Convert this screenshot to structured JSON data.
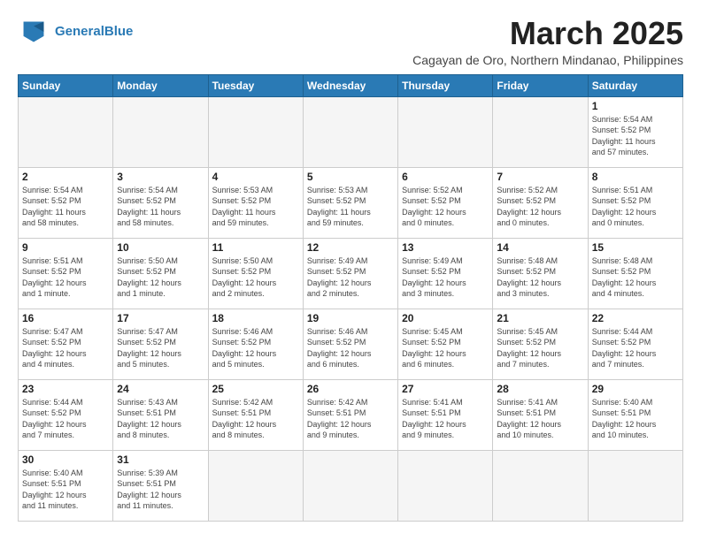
{
  "header": {
    "logo_line1": "General",
    "logo_line2": "Blue",
    "month_title": "March 2025",
    "subtitle": "Cagayan de Oro, Northern Mindanao, Philippines"
  },
  "weekdays": [
    "Sunday",
    "Monday",
    "Tuesday",
    "Wednesday",
    "Thursday",
    "Friday",
    "Saturday"
  ],
  "weeks": [
    [
      {
        "day": "",
        "info": ""
      },
      {
        "day": "",
        "info": ""
      },
      {
        "day": "",
        "info": ""
      },
      {
        "day": "",
        "info": ""
      },
      {
        "day": "",
        "info": ""
      },
      {
        "day": "",
        "info": ""
      },
      {
        "day": "1",
        "info": "Sunrise: 5:54 AM\nSunset: 5:52 PM\nDaylight: 11 hours\nand 57 minutes."
      }
    ],
    [
      {
        "day": "2",
        "info": "Sunrise: 5:54 AM\nSunset: 5:52 PM\nDaylight: 11 hours\nand 58 minutes."
      },
      {
        "day": "3",
        "info": "Sunrise: 5:54 AM\nSunset: 5:52 PM\nDaylight: 11 hours\nand 58 minutes."
      },
      {
        "day": "4",
        "info": "Sunrise: 5:53 AM\nSunset: 5:52 PM\nDaylight: 11 hours\nand 59 minutes."
      },
      {
        "day": "5",
        "info": "Sunrise: 5:53 AM\nSunset: 5:52 PM\nDaylight: 11 hours\nand 59 minutes."
      },
      {
        "day": "6",
        "info": "Sunrise: 5:52 AM\nSunset: 5:52 PM\nDaylight: 12 hours\nand 0 minutes."
      },
      {
        "day": "7",
        "info": "Sunrise: 5:52 AM\nSunset: 5:52 PM\nDaylight: 12 hours\nand 0 minutes."
      },
      {
        "day": "8",
        "info": "Sunrise: 5:51 AM\nSunset: 5:52 PM\nDaylight: 12 hours\nand 0 minutes."
      }
    ],
    [
      {
        "day": "9",
        "info": "Sunrise: 5:51 AM\nSunset: 5:52 PM\nDaylight: 12 hours\nand 1 minute."
      },
      {
        "day": "10",
        "info": "Sunrise: 5:50 AM\nSunset: 5:52 PM\nDaylight: 12 hours\nand 1 minute."
      },
      {
        "day": "11",
        "info": "Sunrise: 5:50 AM\nSunset: 5:52 PM\nDaylight: 12 hours\nand 2 minutes."
      },
      {
        "day": "12",
        "info": "Sunrise: 5:49 AM\nSunset: 5:52 PM\nDaylight: 12 hours\nand 2 minutes."
      },
      {
        "day": "13",
        "info": "Sunrise: 5:49 AM\nSunset: 5:52 PM\nDaylight: 12 hours\nand 3 minutes."
      },
      {
        "day": "14",
        "info": "Sunrise: 5:48 AM\nSunset: 5:52 PM\nDaylight: 12 hours\nand 3 minutes."
      },
      {
        "day": "15",
        "info": "Sunrise: 5:48 AM\nSunset: 5:52 PM\nDaylight: 12 hours\nand 4 minutes."
      }
    ],
    [
      {
        "day": "16",
        "info": "Sunrise: 5:47 AM\nSunset: 5:52 PM\nDaylight: 12 hours\nand 4 minutes."
      },
      {
        "day": "17",
        "info": "Sunrise: 5:47 AM\nSunset: 5:52 PM\nDaylight: 12 hours\nand 5 minutes."
      },
      {
        "day": "18",
        "info": "Sunrise: 5:46 AM\nSunset: 5:52 PM\nDaylight: 12 hours\nand 5 minutes."
      },
      {
        "day": "19",
        "info": "Sunrise: 5:46 AM\nSunset: 5:52 PM\nDaylight: 12 hours\nand 6 minutes."
      },
      {
        "day": "20",
        "info": "Sunrise: 5:45 AM\nSunset: 5:52 PM\nDaylight: 12 hours\nand 6 minutes."
      },
      {
        "day": "21",
        "info": "Sunrise: 5:45 AM\nSunset: 5:52 PM\nDaylight: 12 hours\nand 7 minutes."
      },
      {
        "day": "22",
        "info": "Sunrise: 5:44 AM\nSunset: 5:52 PM\nDaylight: 12 hours\nand 7 minutes."
      }
    ],
    [
      {
        "day": "23",
        "info": "Sunrise: 5:44 AM\nSunset: 5:52 PM\nDaylight: 12 hours\nand 7 minutes."
      },
      {
        "day": "24",
        "info": "Sunrise: 5:43 AM\nSunset: 5:51 PM\nDaylight: 12 hours\nand 8 minutes."
      },
      {
        "day": "25",
        "info": "Sunrise: 5:42 AM\nSunset: 5:51 PM\nDaylight: 12 hours\nand 8 minutes."
      },
      {
        "day": "26",
        "info": "Sunrise: 5:42 AM\nSunset: 5:51 PM\nDaylight: 12 hours\nand 9 minutes."
      },
      {
        "day": "27",
        "info": "Sunrise: 5:41 AM\nSunset: 5:51 PM\nDaylight: 12 hours\nand 9 minutes."
      },
      {
        "day": "28",
        "info": "Sunrise: 5:41 AM\nSunset: 5:51 PM\nDaylight: 12 hours\nand 10 minutes."
      },
      {
        "day": "29",
        "info": "Sunrise: 5:40 AM\nSunset: 5:51 PM\nDaylight: 12 hours\nand 10 minutes."
      }
    ],
    [
      {
        "day": "30",
        "info": "Sunrise: 5:40 AM\nSunset: 5:51 PM\nDaylight: 12 hours\nand 11 minutes."
      },
      {
        "day": "31",
        "info": "Sunrise: 5:39 AM\nSunset: 5:51 PM\nDaylight: 12 hours\nand 11 minutes."
      },
      {
        "day": "",
        "info": ""
      },
      {
        "day": "",
        "info": ""
      },
      {
        "day": "",
        "info": ""
      },
      {
        "day": "",
        "info": ""
      },
      {
        "day": "",
        "info": ""
      }
    ]
  ]
}
